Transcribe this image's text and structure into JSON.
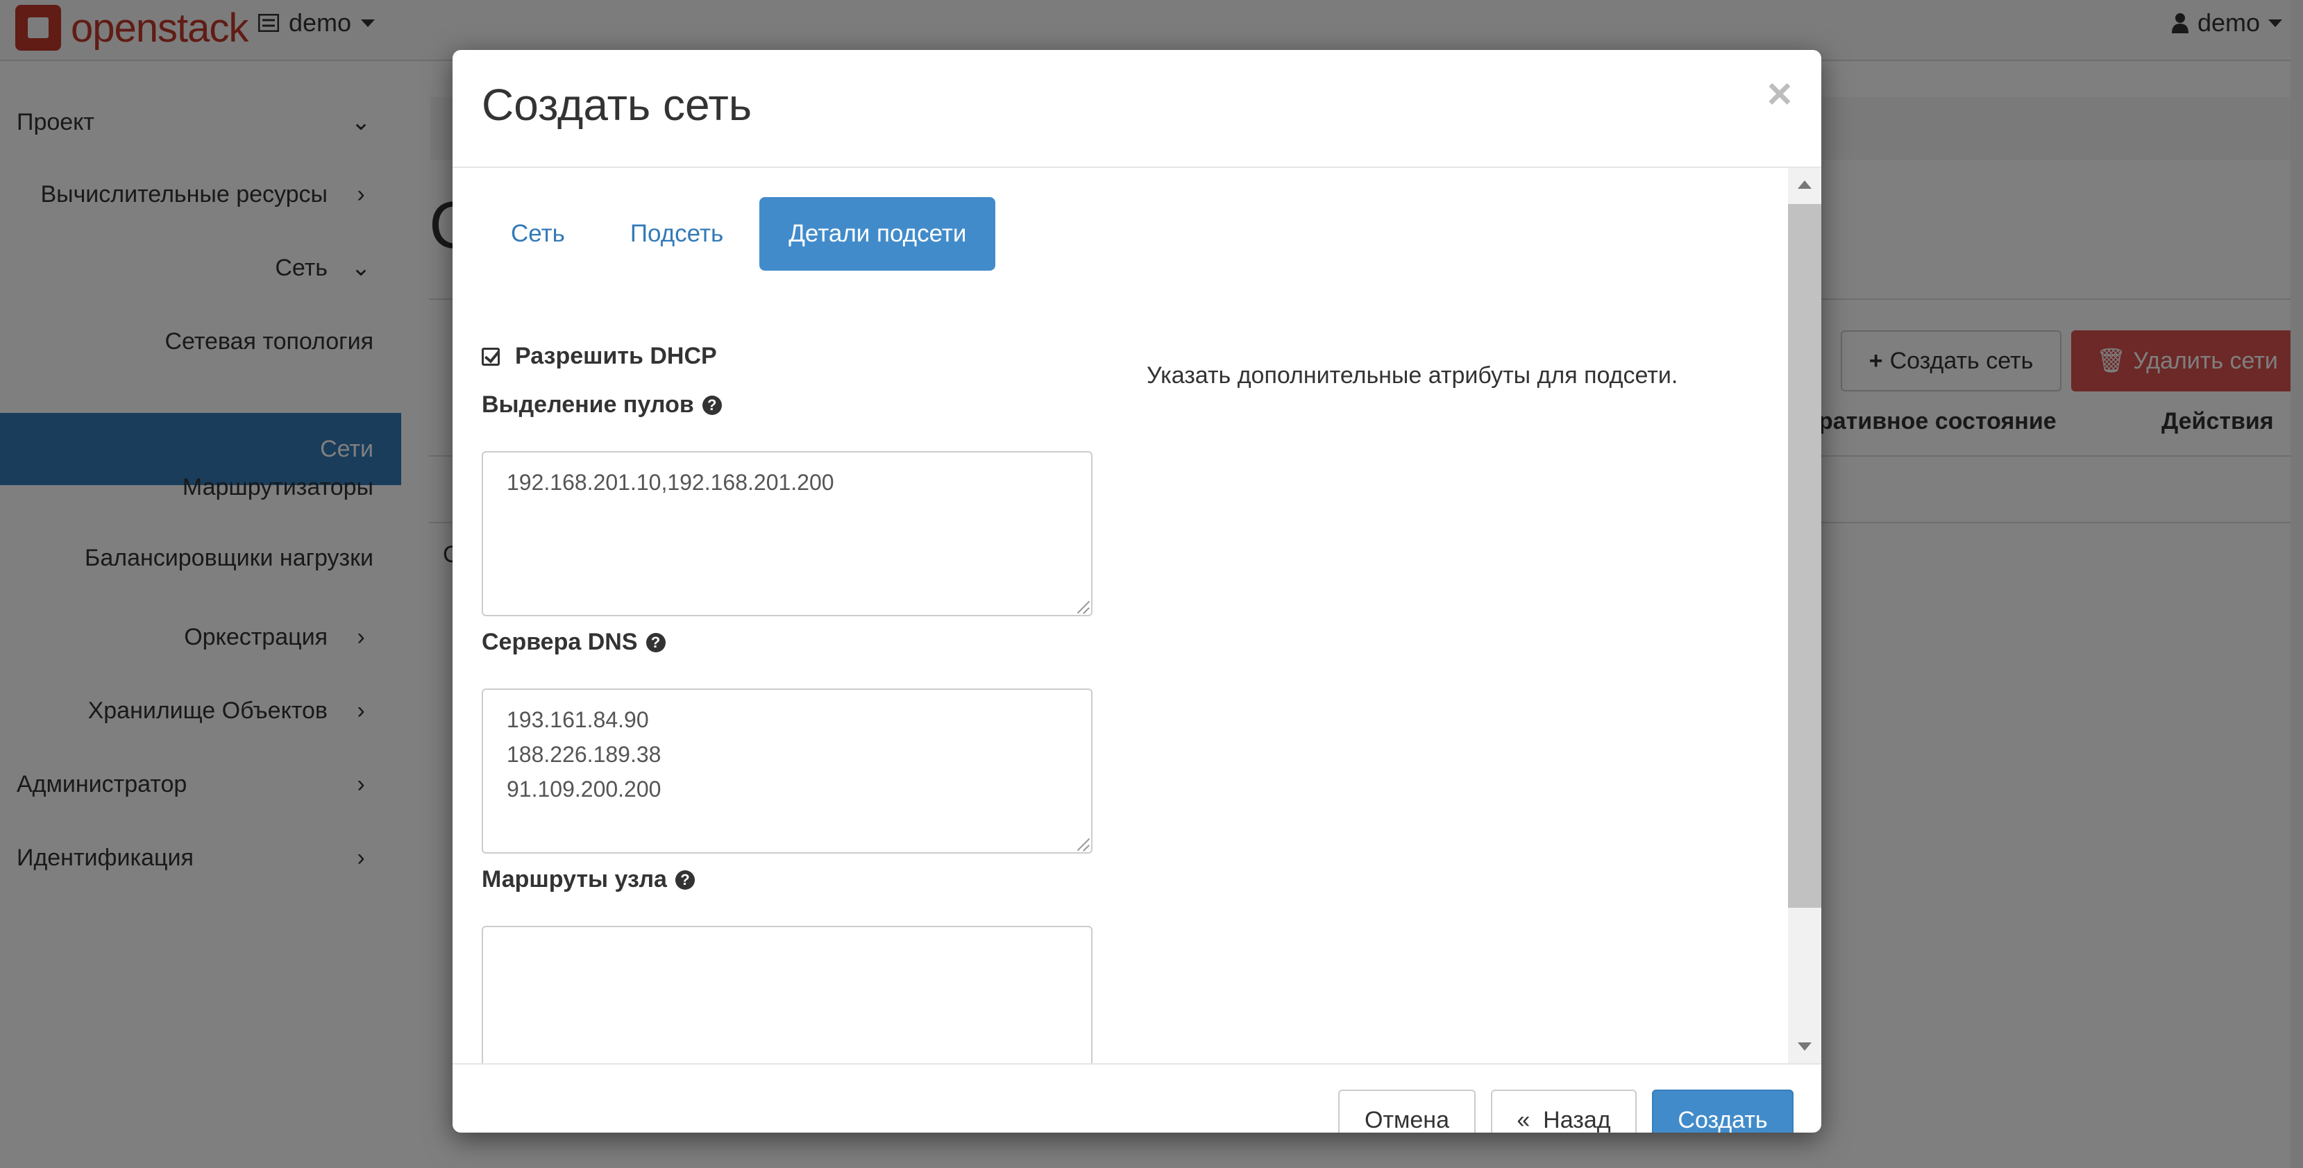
{
  "topbar": {
    "logo_text": "openstack",
    "project": "demo",
    "user": "demo"
  },
  "sidebar": {
    "items": [
      {
        "label": "Проект",
        "chevron": "▾"
      },
      {
        "label": "Вычислительные ресурсы",
        "chevron": "›"
      },
      {
        "label": "Сеть",
        "chevron": "▾"
      },
      {
        "label": "Сетевая топология"
      },
      {
        "label": "Сети"
      },
      {
        "label": "Маршрутизаторы"
      },
      {
        "label": "Балансировщики нагрузки"
      },
      {
        "label": "Оркестрация",
        "chevron": "›"
      },
      {
        "label": "Хранилище Объектов",
        "chevron": "›"
      },
      {
        "label": "Администратор",
        "chevron": "›"
      },
      {
        "label": "Идентификация",
        "chevron": "›"
      }
    ],
    "active_color": "#337ab7"
  },
  "background": {
    "page_title_initial": "С",
    "create_network_button": "Создать сеть",
    "delete_networks_button": "Удалить сети",
    "columns": [
      "ративное состояние",
      "Действия"
    ],
    "row_initial": "С"
  },
  "modal": {
    "title": "Создать сеть",
    "close": "×",
    "tabs": [
      {
        "label": "Сеть",
        "active": false
      },
      {
        "label": "Подсеть",
        "active": false
      },
      {
        "label": "Детали подсети",
        "active": true
      }
    ],
    "dhcp_label": "Разрешить DHCP",
    "dhcp_checked": true,
    "allocation_pools": {
      "label": "Выделение пулов",
      "value": "192.168.201.10,192.168.201.200"
    },
    "dns_servers": {
      "label": "Сервера DNS",
      "value": "193.161.84.90\n188.226.189.38\n91.109.200.200"
    },
    "host_routes": {
      "label": "Маршруты узла",
      "value": ""
    },
    "help_text": "Указать дополнительные атрибуты для подсети.",
    "footer": {
      "cancel": "Отмена",
      "back": "«  Назад",
      "create": "Создать"
    }
  }
}
